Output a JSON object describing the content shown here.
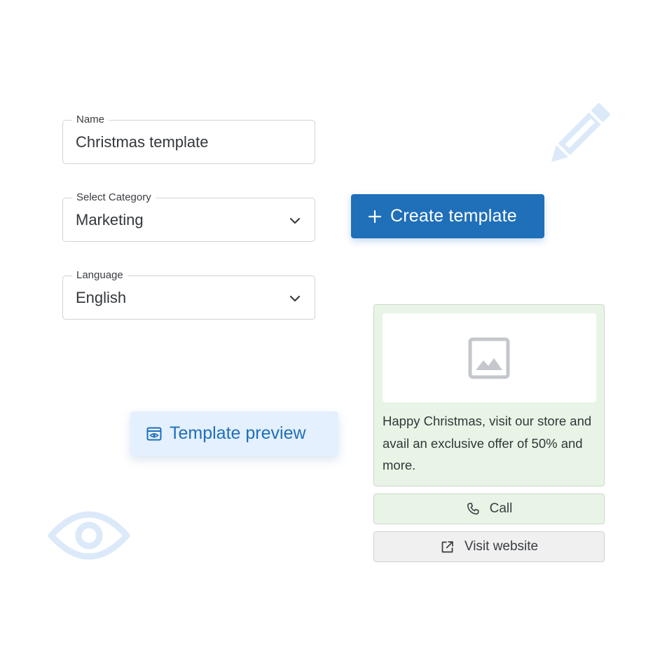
{
  "form": {
    "name": {
      "label": "Name",
      "value": "Christmas template"
    },
    "category": {
      "label": "Select Category",
      "value": "Marketing",
      "icon": "chevron-down-icon"
    },
    "language": {
      "label": "Language",
      "value": "English",
      "icon": "chevron-down-icon"
    }
  },
  "create_button": {
    "icon": "plus-icon",
    "label": "Create template"
  },
  "preview_chip": {
    "icon": "preview-window-icon",
    "label": "Template preview"
  },
  "message_preview": {
    "media_icon": "image-placeholder-icon",
    "body": "Happy Christmas, visit our store and avail an exclusive offer of 50% and more.",
    "buttons": [
      {
        "icon": "phone-icon",
        "label": "Call"
      },
      {
        "icon": "external-link-icon",
        "label": "Visit website"
      }
    ]
  },
  "decorations": [
    "pencil-icon",
    "eye-icon"
  ],
  "colors": {
    "primary": "#1f6fb9",
    "preview_chip_bg": "#e4f0fd",
    "message_bg": "#e8f5e6",
    "secondary_button_bg": "#f0f0f0",
    "decoration": "#dbe9f9"
  }
}
